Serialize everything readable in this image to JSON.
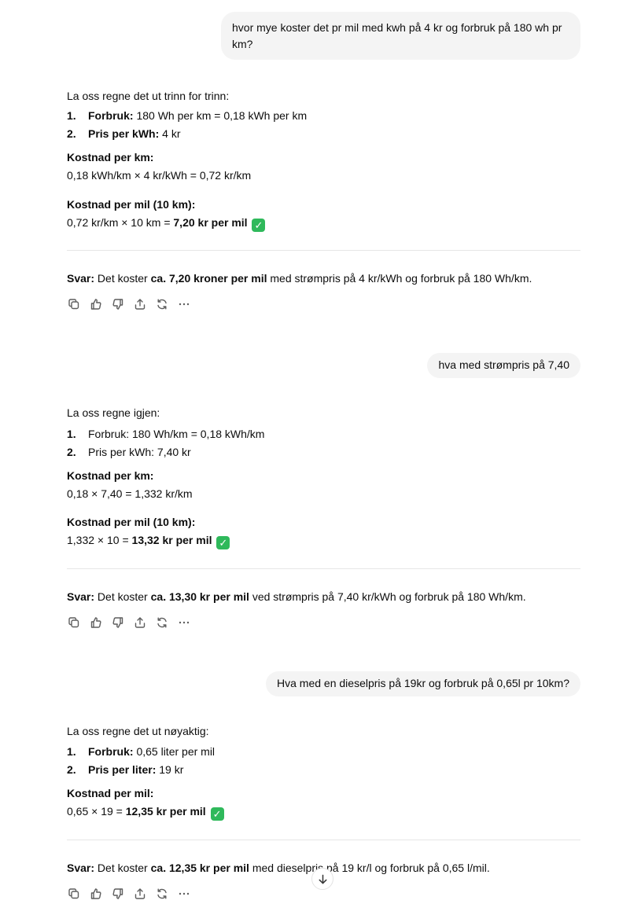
{
  "conversation": {
    "q1": "hvor mye koster det pr mil med kwh på 4 kr og forbruk på 180 wh pr km?",
    "a1": {
      "intro": "La oss regne det ut trinn for trinn:",
      "item1_label": "Forbruk:",
      "item1_text": " 180 Wh per km = 0,18 kWh per km",
      "item2_label": "Pris per kWh:",
      "item2_text": " 4 kr",
      "h_km": "Kostnad per km:",
      "calc_km": "0,18 kWh/km × 4 kr/kWh = 0,72 kr/km",
      "h_mil": "Kostnad per mil (10 km):",
      "calc_mil_pre": "0,72 kr/km × 10 km = ",
      "calc_mil_bold": "7,20 kr per mil",
      "svar_label": "Svar:",
      "svar_pre": " Det koster ",
      "svar_bold": "ca. 7,20 kroner per mil",
      "svar_post": " med strømpris på 4 kr/kWh og forbruk på 180 Wh/km."
    },
    "q2": "hva med strømpris på 7,40",
    "a2": {
      "intro": "La oss regne igjen:",
      "item1": "Forbruk: 180 Wh/km = 0,18 kWh/km",
      "item2": "Pris per kWh: 7,40 kr",
      "h_km": "Kostnad per km:",
      "calc_km": "0,18 × 7,40 = 1,332 kr/km",
      "h_mil": "Kostnad per mil (10 km):",
      "calc_mil_pre": "1,332 × 10 = ",
      "calc_mil_bold": "13,32 kr per mil",
      "svar_label": "Svar:",
      "svar_pre": " Det koster ",
      "svar_bold": "ca. 13,30 kr per mil",
      "svar_post": " ved strømpris på 7,40 kr/kWh og forbruk på 180 Wh/km."
    },
    "q3": "Hva med en dieselpris på 19kr og forbruk på 0,65l pr 10km?",
    "a3": {
      "intro": "La oss regne det ut nøyaktig:",
      "item1_label": "Forbruk:",
      "item1_text": " 0,65 liter per mil",
      "item2_label": "Pris per liter:",
      "item2_text": " 19 kr",
      "h_mil": "Kostnad per mil:",
      "calc_mil_pre": "0,65 × 19 = ",
      "calc_mil_bold": "12,35 kr per mil",
      "svar_label": "Svar:",
      "svar_pre": " Det koster ",
      "svar_bold": "ca. 12,35 kr per mil",
      "svar_post": " med dieselpris på 19 kr/l og forbruk på 0,65 l/mil."
    }
  },
  "list_numbers": [
    "1.",
    "2."
  ],
  "check_glyph": "✓",
  "icons": [
    "copy-icon",
    "thumbs-up-icon",
    "thumbs-down-icon",
    "share-icon",
    "regenerate-icon",
    "more-icon",
    "scroll-down-icon"
  ],
  "colors": {
    "bubble_bg": "#f4f4f4",
    "check_green": "#2fb95b",
    "divider": "#e6e6e6",
    "icon_gray": "#5d5d5d"
  }
}
